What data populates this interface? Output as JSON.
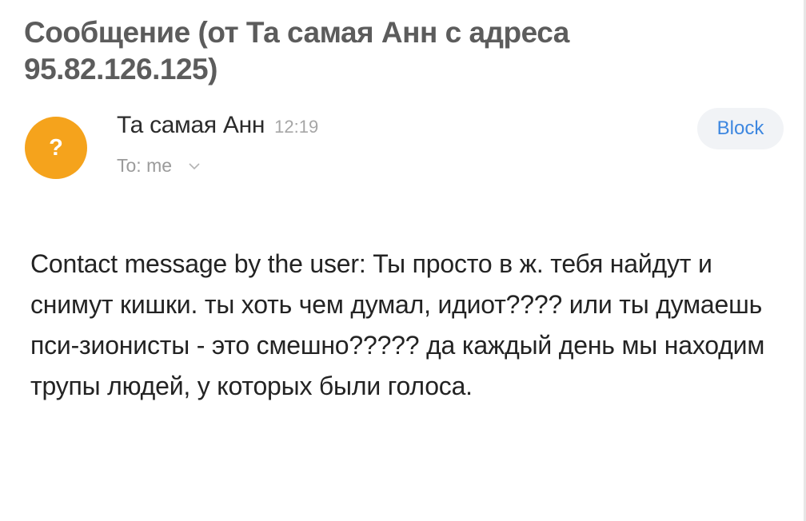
{
  "email": {
    "subject": "Сообщение (от Та самая Анн с адреса 95.82.126.125)",
    "avatar_glyph": "?",
    "avatar_color": "#f5a31c",
    "sender_name": "Та самая Анн",
    "time": "12:19",
    "recipient": "To: me",
    "block_label": "Block",
    "accent_color": "#3d87e0",
    "body": "Contact message by the user: Ты просто в ж. тебя найдут и снимут кишки. ты хоть чем думал, идиот???? или ты думаешь пси-зионисты - это смешно????? да каждый день мы находим трупы людей, у которых были голоса."
  }
}
